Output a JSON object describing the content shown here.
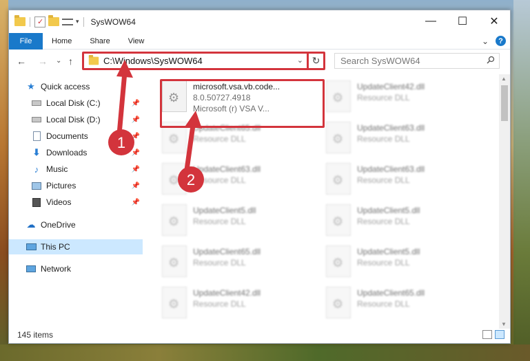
{
  "window": {
    "title": "SysWOW64"
  },
  "titlebar": {
    "min": "—",
    "max": "☐",
    "close": "✕"
  },
  "ribbon": {
    "file": "File",
    "tabs": [
      "Home",
      "Share",
      "View"
    ],
    "collapse": "⌄",
    "help": "?"
  },
  "nav": {
    "back": "←",
    "forward": "→",
    "recent": "⌄",
    "up": "↑"
  },
  "address": {
    "path": "C:\\Windows\\SysWOW64",
    "dropdown": "⌄",
    "refresh": "↻"
  },
  "search": {
    "placeholder": "Search SysWOW64",
    "icon": "search-icon"
  },
  "sidebar": {
    "quick_access": "Quick access",
    "items": [
      {
        "label": "Local Disk (C:)",
        "icon": "drive-icon"
      },
      {
        "label": "Local Disk (D:)",
        "icon": "drive-icon"
      },
      {
        "label": "Documents",
        "icon": "documents-icon"
      },
      {
        "label": "Downloads",
        "icon": "download-icon"
      },
      {
        "label": "Music",
        "icon": "music-icon"
      },
      {
        "label": "Pictures",
        "icon": "pictures-icon"
      },
      {
        "label": "Videos",
        "icon": "videos-icon"
      }
    ],
    "onedrive": "OneDrive",
    "this_pc": "This PC",
    "network": "Network"
  },
  "files": [
    {
      "name": "microsoft.vsa.vb.code...",
      "line2": "8.0.50727.4918",
      "line3": "Microsoft (r) VSA V..."
    },
    {
      "name": "UpdateClient42.dll",
      "line2": "Resource DLL"
    },
    {
      "name": "UpdateClient65.dll",
      "line2": "Resource DLL"
    },
    {
      "name": "UpdateClient63.dll",
      "line2": "Resource DLL"
    },
    {
      "name": "UpdateClient63.dll",
      "line2": "Resource DLL"
    },
    {
      "name": "UpdateClient63.dll",
      "line2": "Resource DLL"
    },
    {
      "name": "UpdateClient5.dll",
      "line2": "Resource DLL"
    },
    {
      "name": "UpdateClient5.dll",
      "line2": "Resource DLL"
    },
    {
      "name": "UpdateClient65.dll",
      "line2": "Resource DLL"
    },
    {
      "name": "UpdateClient5.dll",
      "line2": "Resource DLL"
    },
    {
      "name": "UpdateClient42.dll",
      "line2": "Resource DLL"
    },
    {
      "name": "UpdateClient65.dll",
      "line2": "Resource DLL"
    }
  ],
  "status": {
    "items": "145 items"
  },
  "annotations": {
    "step1": "1",
    "step2": "2",
    "color": "#d3343c"
  }
}
